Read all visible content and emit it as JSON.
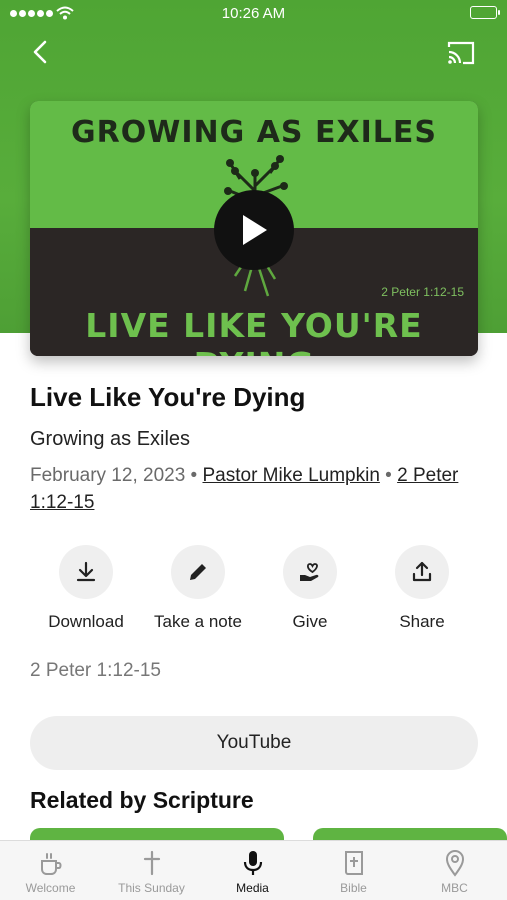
{
  "status_bar": {
    "time": "10:26 AM"
  },
  "artwork": {
    "series_text": "GROWING AS EXILES",
    "title_text": "LIVE LIKE YOU'RE DYING",
    "scripture_text": "2 Peter 1:12-15"
  },
  "sermon": {
    "title": "Live Like You're Dying",
    "series": "Growing as Exiles",
    "date": "February 12, 2023",
    "separator": "•",
    "speaker": "Pastor Mike Lumpkin",
    "scripture_link": "2 Peter 1:12-15",
    "scripture_ref": "2 Peter 1:12-15"
  },
  "actions": [
    {
      "label": "Download",
      "icon": "download-icon"
    },
    {
      "label": "Take a note",
      "icon": "pencil-icon"
    },
    {
      "label": "Give",
      "icon": "give-heart-hand-icon"
    },
    {
      "label": "Share",
      "icon": "share-icon"
    }
  ],
  "youtube_label": "YouTube",
  "related": {
    "title": "Related by Scripture"
  },
  "tabs": [
    {
      "label": "Welcome",
      "icon": "coffee-cup-icon",
      "active": false
    },
    {
      "label": "This Sunday",
      "icon": "cross-icon",
      "active": false
    },
    {
      "label": "Media",
      "icon": "microphone-icon",
      "active": true
    },
    {
      "label": "Bible",
      "icon": "bible-icon",
      "active": false
    },
    {
      "label": "MBC",
      "icon": "location-pin-icon",
      "active": false
    }
  ],
  "colors": {
    "brand_green": "#58ad3b",
    "art_dark": "#2b2625",
    "art_title_green": "#6ec04e"
  }
}
